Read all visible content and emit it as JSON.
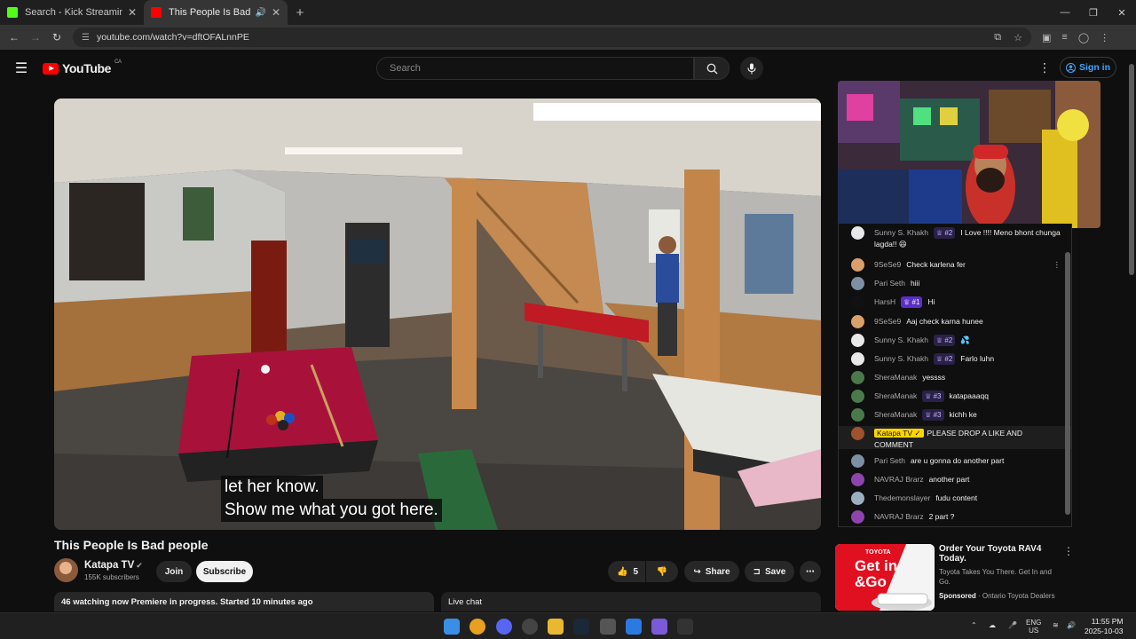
{
  "browser": {
    "tabs": [
      {
        "label": "Search - Kick Streaming",
        "favicon_color": "#53fc18"
      },
      {
        "label": "This People Is Bad people",
        "favicon_color": "#ff0000"
      }
    ],
    "new_tab": "+",
    "url": "youtube.com/watch?v=dftOFALnnPE"
  },
  "youtube": {
    "logo_text": "YouTube",
    "region": "CA",
    "search_placeholder": "Search",
    "sign_in_label": "Sign in"
  },
  "video": {
    "caption_line1": "let her know.",
    "caption_line2": "Show me what you got here.",
    "title": "This People Is Bad people"
  },
  "channel": {
    "name": "Katapa TV",
    "subscribers": "155K subscribers",
    "join_label": "Join",
    "subscribe_label": "Subscribe"
  },
  "actions": {
    "like_count": "5",
    "share_label": "Share",
    "save_label": "Save"
  },
  "description": {
    "text": "46 watching now  Premiere in progress. Started 10 minutes ago"
  },
  "live_chat_label": "Live chat",
  "chat": [
    {
      "name": "Sunny S. Khakh",
      "badge": "#2",
      "text": "I Love !!!! Meno bhont chunga lagda!! 😆",
      "avatar_color": "#e8e8e8"
    },
    {
      "name": "9SeSe9",
      "badge": "",
      "text": "Check karlena fer",
      "avatar_color": "#d9a06b"
    },
    {
      "name": "Pari Seth",
      "badge": "",
      "text": "hiii",
      "avatar_color": "#7d8fa3"
    },
    {
      "name": "HarsH",
      "badge": "#1",
      "text": "Hi",
      "avatar_color": "#111111"
    },
    {
      "name": "9SeSe9",
      "badge": "",
      "text": "Aaj check karna hunee",
      "avatar_color": "#d9a06b"
    },
    {
      "name": "Sunny S. Khakh",
      "badge": "#2",
      "text": "💦",
      "avatar_color": "#e8e8e8"
    },
    {
      "name": "Sunny S. Khakh",
      "badge": "#2",
      "text": "Farlo luhn",
      "avatar_color": "#e8e8e8"
    },
    {
      "name": "SheraManak",
      "badge": "",
      "text": "yessss",
      "avatar_color": "#4a7a4a"
    },
    {
      "name": "SheraManak",
      "badge": "#3",
      "text": "katapaaaqq",
      "avatar_color": "#4a7a4a"
    },
    {
      "name": "SheraManak",
      "badge": "#3",
      "text": "kichh ke",
      "avatar_color": "#4a7a4a"
    },
    {
      "name": "Katapa TV",
      "badge": "owner",
      "text": "PLEASE DROP A LIKE AND COMMENT",
      "avatar_color": "#a0522d"
    },
    {
      "name": "Pari Seth",
      "badge": "",
      "text": "are u gonna do another part",
      "avatar_color": "#7d8fa3"
    },
    {
      "name": "NAVRAJ Brarz",
      "badge": "",
      "text": "another part",
      "avatar_color": "#8e44ad"
    },
    {
      "name": "Thedemonslayer",
      "badge": "",
      "text": "fudu content",
      "avatar_color": "#9ab0c0"
    },
    {
      "name": "NAVRAJ Brarz",
      "badge": "",
      "text": "2 part ?",
      "avatar_color": "#8e44ad"
    }
  ],
  "ad": {
    "image_text_brand": "TOYOTA",
    "image_text_line1": "Get in",
    "image_text_line2": "&Go",
    "title": "Order Your Toyota RAV4 Today.",
    "subtitle": "Toyota Takes You There. Get In and Go.",
    "sponsored": "Sponsored",
    "advertiser": "Ontario Toyota Dealers"
  },
  "taskbar": {
    "lang_line1": "ENG",
    "lang_line2": "US",
    "time": "11:55 PM",
    "date": "2025-10-03"
  }
}
